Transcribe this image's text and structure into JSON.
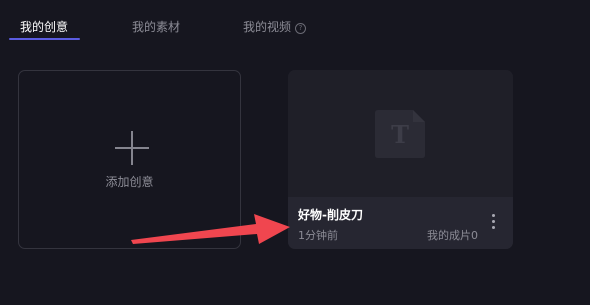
{
  "tabs": [
    {
      "label": "我的创意",
      "active": true
    },
    {
      "label": "我的素材",
      "active": false
    },
    {
      "label": "我的视频",
      "active": false,
      "icon": "help-icon"
    }
  ],
  "add_card": {
    "label": "添加创意",
    "icon": "plus-icon"
  },
  "project": {
    "title": "好物-削皮刀",
    "time": "1分钟前",
    "count_label": "我的成片0",
    "thumbnail_icon": "text-document-icon",
    "thumbnail_letter": "T",
    "menu_icon": "more-vertical-icon"
  },
  "annotation": {
    "type": "arrow",
    "color": "#f0464f"
  },
  "colors": {
    "background": "#16161f",
    "accent": "#5b5ce0",
    "card": "#1f1f28",
    "card_footer": "#262631",
    "muted_text": "#8c8c96"
  }
}
